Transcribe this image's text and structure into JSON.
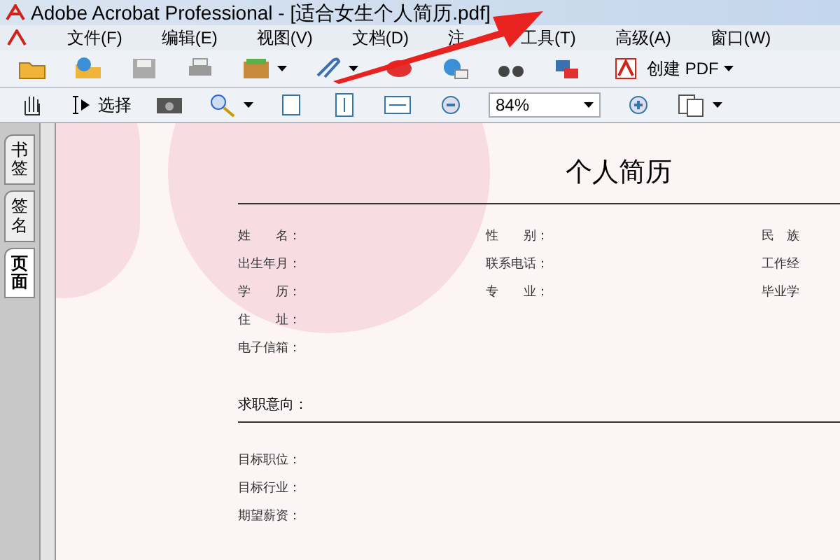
{
  "window": {
    "title": "Adobe Acrobat Professional - [适合女生个人简历.pdf]"
  },
  "menu": [
    "文件(F)",
    "编辑(E)",
    "视图(V)",
    "文档(D)",
    "注",
    "工具(T)",
    "高级(A)",
    "窗口(W)"
  ],
  "toolbar": {
    "create_pdf": "创建 PDF"
  },
  "toolbar2": {
    "select": "选择",
    "zoom": "84%"
  },
  "side_tabs": [
    {
      "label": "书签",
      "selected": false
    },
    {
      "label": "签名",
      "selected": false
    },
    {
      "label": "页面",
      "selected": true
    }
  ],
  "document": {
    "title": "个人简历",
    "fields": [
      [
        "姓　　名：",
        "性　　别：",
        "民　族"
      ],
      [
        "出生年月：",
        "联系电话：",
        "工作经"
      ],
      [
        "学　　历：",
        "专　　业：",
        "毕业学"
      ],
      [
        "住　　址："
      ],
      [
        "电子信箱："
      ]
    ],
    "section": "求职意向：",
    "section_fields": [
      "目标职位：",
      "目标行业：",
      "期望薪资："
    ]
  }
}
